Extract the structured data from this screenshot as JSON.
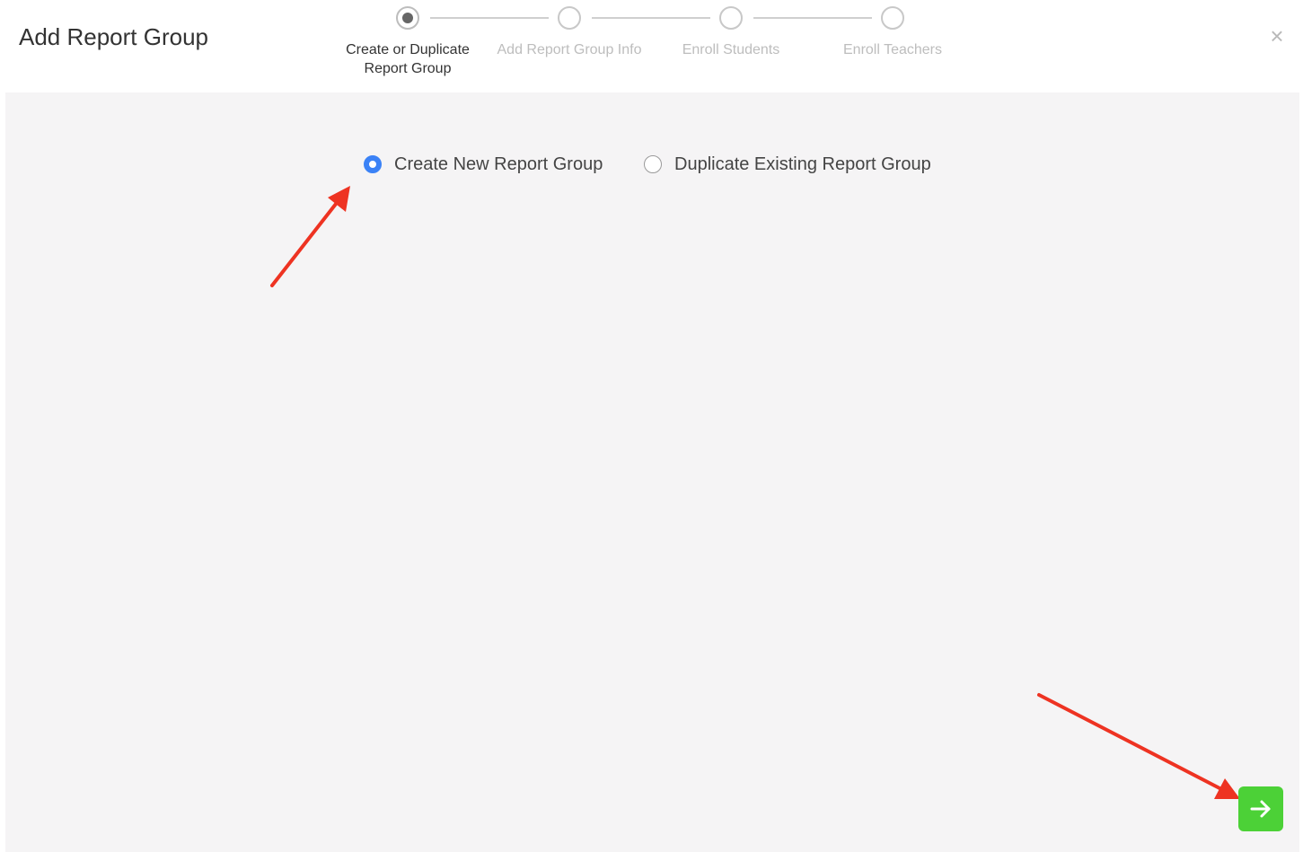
{
  "dialog": {
    "title": "Add Report Group",
    "close_label": "×"
  },
  "stepper": {
    "steps": [
      {
        "label_line1": "Create or Duplicate",
        "label_line2": "Report Group",
        "state": "active"
      },
      {
        "label_line1": "Add Report Group Info",
        "label_line2": "",
        "state": "inactive"
      },
      {
        "label_line1": "Enroll Students",
        "label_line2": "",
        "state": "inactive"
      },
      {
        "label_line1": "Enroll Teachers",
        "label_line2": "",
        "state": "inactive"
      }
    ]
  },
  "options": {
    "selected": "create_new",
    "create_new_label": "Create New Report Group",
    "duplicate_label": "Duplicate Existing Report Group"
  },
  "footer": {
    "next_icon": "arrow-right-icon"
  },
  "colors": {
    "accent_blue": "#3b82f6",
    "next_green": "#4cd137",
    "annotation_red": "#ee3322"
  }
}
